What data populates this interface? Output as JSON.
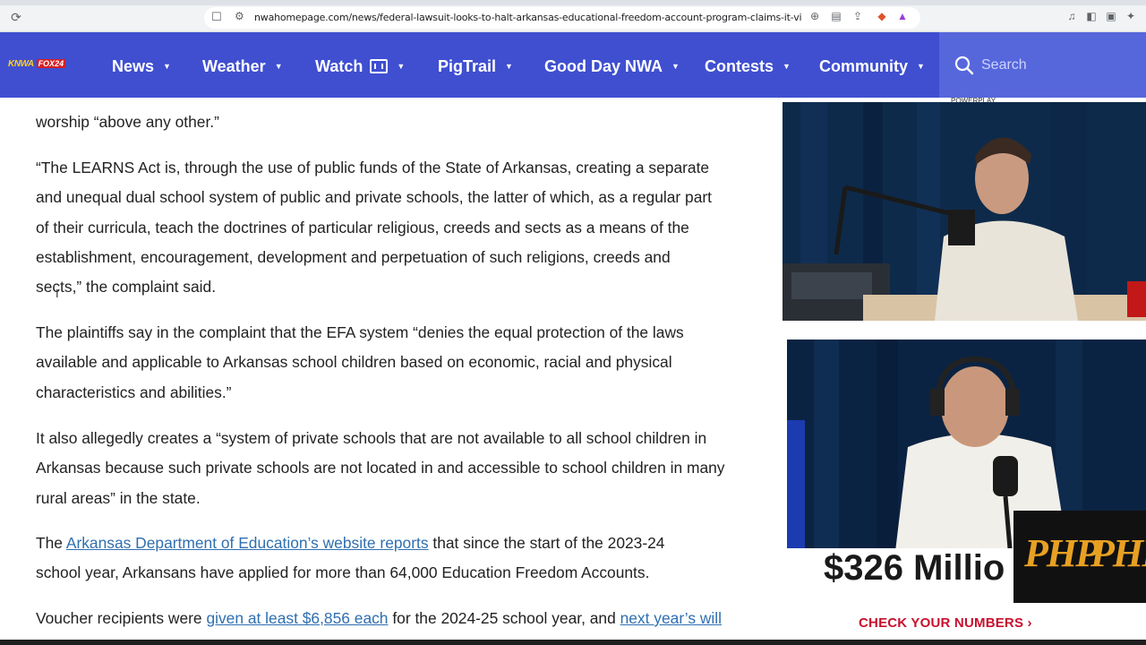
{
  "browser": {
    "url": "nwahomepage.com/news/federal-lawsuit-looks-to-halt-arkansas-educational-freedom-account-program-claims-it-violates-us-constitutio..."
  },
  "site": {
    "logo_primary": "KNWA",
    "logo_secondary": "FOX24",
    "nav": [
      "News",
      "Weather",
      "Watch",
      "PigTrail",
      "Good Day NWA",
      "Contests",
      "Community"
    ],
    "search_placeholder": "Search",
    "nav_color": "#3f4fd0",
    "search_bg_color": "#5667dc",
    "link_color": "#2f6fb0"
  },
  "article": {
    "p0": "worship “above any other.”",
    "p1_line1": "“The LEARNS Act is, through the use of public funds of the State of Arkansas, creating a separate",
    "p1_line2": "and unequal dual school system of public and private schools, the latter of which, as a regular part",
    "p1_line3": "of their curricula, teach the doctrines of particular religious, creeds and sects as a means of the",
    "p1_line4": "establishment, encouragement, development and perpetuation of such religions, creeds and",
    "p1_line5": "sects,” the complaint said.",
    "p2_line1": "The plaintiffs say in the complaint that the EFA system “denies the equal protection of the laws",
    "p2_line2": "available and applicable to Arkansas school children based on economic, racial and physical",
    "p2_line3": "characteristics and abilities.”",
    "p3_line1": "It also allegedly creates a “system of private schools that are not available to all school children in",
    "p3_line2": "Arkansas because such private schools are not located in and accessible to school children in many",
    "p3_line3": "rural areas” in the state.",
    "p4_prefix": "The ",
    "p4_link": "Arkansas Department of Education’s website reports",
    "p4_suffix": " that since the start of the 2023-24",
    "p4_line2": "school year, Arkansans have applied for more than 64,000 Education Freedom Accounts.",
    "p5_prefix": "Voucher recipients were ",
    "p5_link1": "given at least $6,856 each",
    "p5_middle": " for the 2024-25 school year, and ",
    "p5_link2": "next year’s will"
  },
  "sidebar": {
    "ad_amount": "$326 Millio",
    "ad_cta": "CHECK YOUR NUMBERS ›",
    "badge_logo": "PHP",
    "overlay_tag": "POWERPLAY"
  }
}
